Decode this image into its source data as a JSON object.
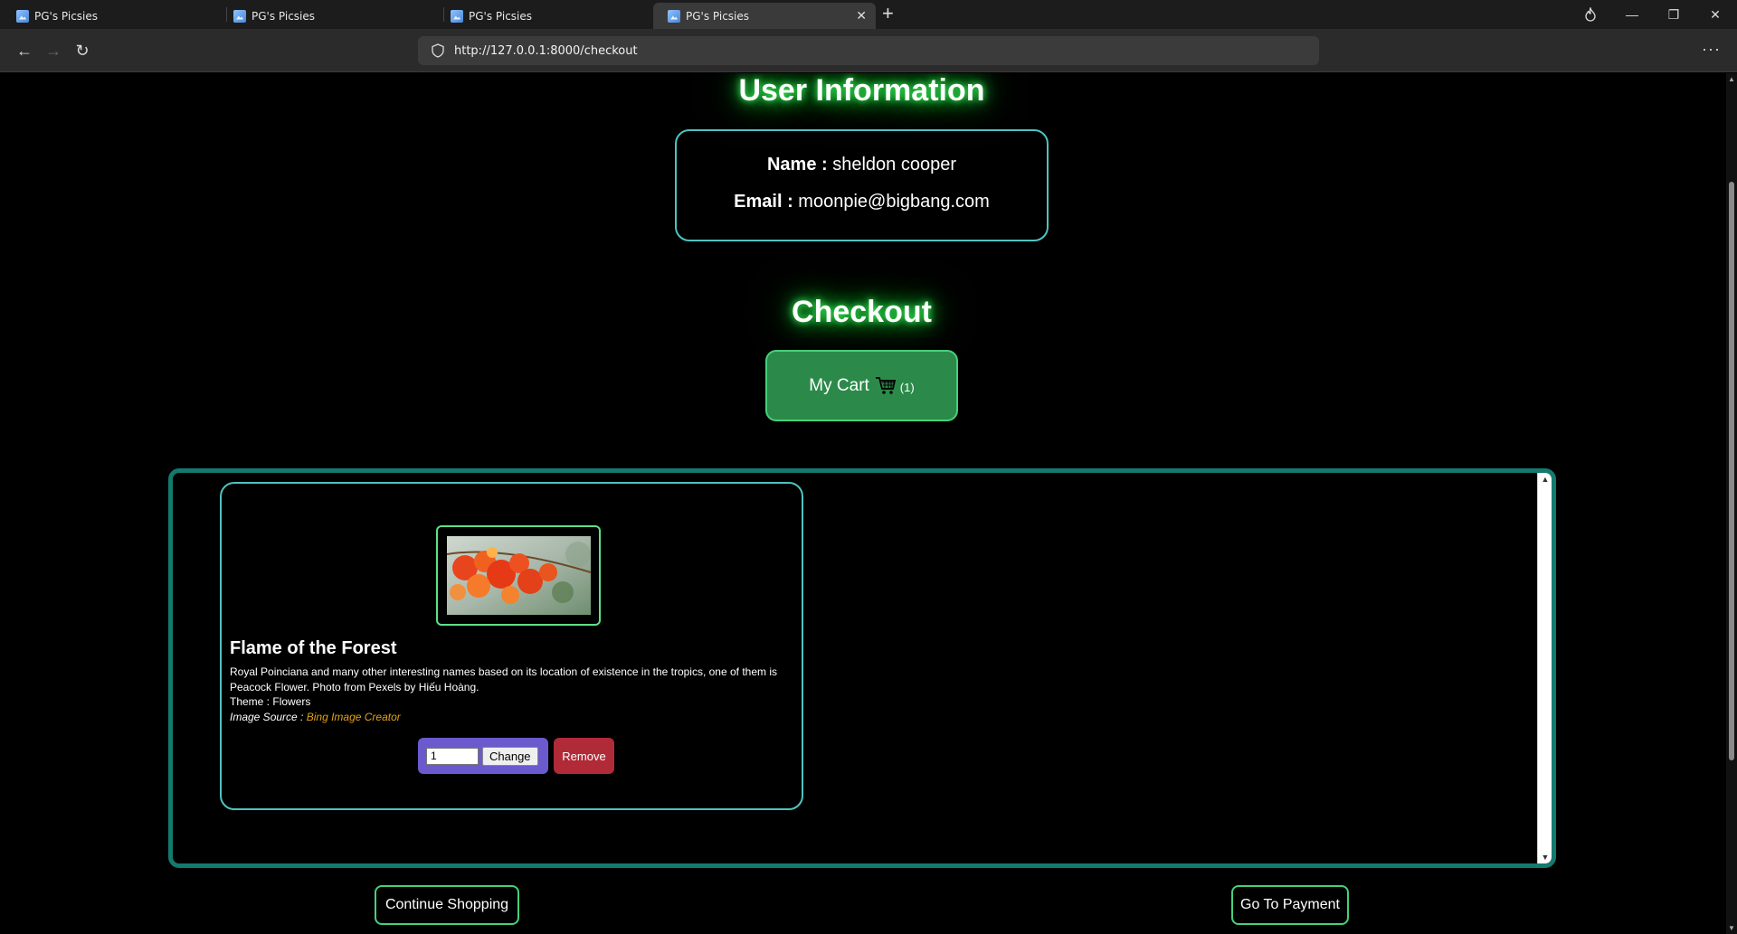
{
  "browser": {
    "tabs": [
      {
        "title": "PG's Picsies"
      },
      {
        "title": "PG's Picsies"
      },
      {
        "title": "PG's Picsies"
      },
      {
        "title": "PG's Picsies"
      }
    ],
    "url": "http://127.0.0.1:8000/checkout"
  },
  "user_info": {
    "heading": "User Information",
    "name_label": "Name :",
    "name_value": "sheldon cooper",
    "email_label": "Email :",
    "email_value": "moonpie@bigbang.com"
  },
  "checkout": {
    "heading": "Checkout",
    "cart_label": "My Cart",
    "cart_count": "(1)"
  },
  "cart_items": [
    {
      "title": "Flame of the Forest",
      "description": "Royal Poinciana and many other interesting names based on its location of existence in the tropics, one of them is Peacock Flower. Photo from Pexels by Hiếu Hoàng.",
      "theme_label": "Theme :",
      "theme_value": "Flowers",
      "source_label": "Image Source :",
      "source_value": "Bing Image Creator",
      "quantity": "1",
      "change_label": "Change",
      "remove_label": "Remove"
    }
  ],
  "actions": {
    "continue_label": "Continue Shopping",
    "payment_label": "Go To Payment"
  },
  "colors": {
    "accent_teal": "#4fc3c0",
    "cart_green": "#2b8a4a",
    "qty_purple": "#6a5acd",
    "remove_red": "#b02a37",
    "link_orange": "#e0a21a"
  }
}
